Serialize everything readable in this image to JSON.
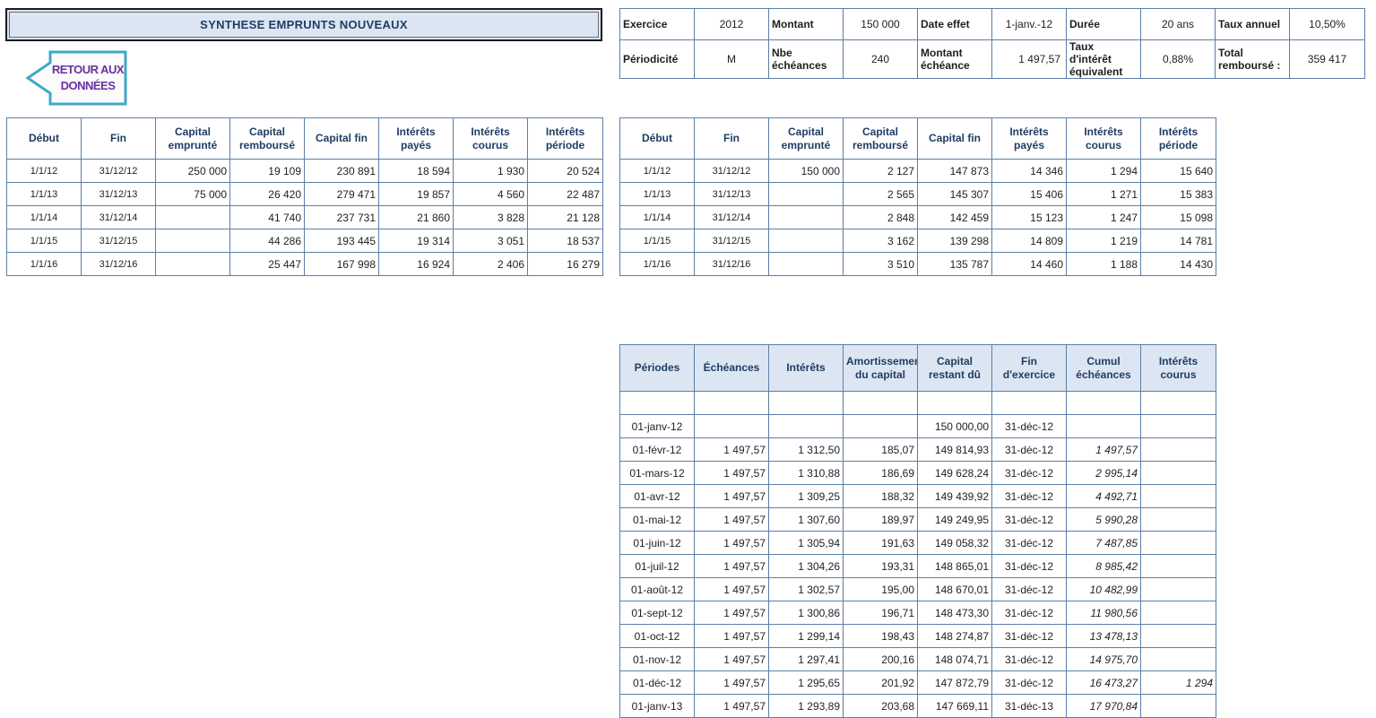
{
  "title": "SYNTHESE EMPRUNTS NOUVEAUX",
  "back_button": {
    "label_line1": "RETOUR AUX",
    "label_line2": "DONNÉES",
    "icon": "arrow-left-icon"
  },
  "summary": {
    "row1": [
      "Exercice",
      "2012",
      "Montant",
      "150 000",
      "Date effet",
      "1-janv.-12",
      "Durée",
      "20 ans",
      "Taux annuel",
      "10,50%"
    ],
    "row2": [
      "Périodicité",
      "M",
      "Nbe échéances",
      "240",
      "Montant échéance",
      "1 497,57",
      "Taux d'intérêt équivalent",
      "0,88%",
      "Total remboursé :",
      "359 417"
    ]
  },
  "synthesis_headers": [
    "Début",
    "Fin",
    "Capital emprunté",
    "Capital remboursé",
    "Capital fin",
    "Intérêts payés",
    "Intérêts courus",
    "Intérêts période"
  ],
  "synthesis_left": [
    [
      "1/1/12",
      "31/12/12",
      "250 000",
      "19 109",
      "230 891",
      "18 594",
      "1 930",
      "20 524"
    ],
    [
      "1/1/13",
      "31/12/13",
      "75 000",
      "26 420",
      "279 471",
      "19 857",
      "4 560",
      "22 487"
    ],
    [
      "1/1/14",
      "31/12/14",
      "",
      "41 740",
      "237 731",
      "21 860",
      "3 828",
      "21 128"
    ],
    [
      "1/1/15",
      "31/12/15",
      "",
      "44 286",
      "193 445",
      "19 314",
      "3 051",
      "18 537"
    ],
    [
      "1/1/16",
      "31/12/16",
      "",
      "25 447",
      "167 998",
      "16 924",
      "2 406",
      "16 279"
    ]
  ],
  "synthesis_right": [
    [
      "1/1/12",
      "31/12/12",
      "150 000",
      "2 127",
      "147 873",
      "14 346",
      "1 294",
      "15 640"
    ],
    [
      "1/1/13",
      "31/12/13",
      "",
      "2 565",
      "145 307",
      "15 406",
      "1 271",
      "15 383"
    ],
    [
      "1/1/14",
      "31/12/14",
      "",
      "2 848",
      "142 459",
      "15 123",
      "1 247",
      "15 098"
    ],
    [
      "1/1/15",
      "31/12/15",
      "",
      "3 162",
      "139 298",
      "14 809",
      "1 219",
      "14 781"
    ],
    [
      "1/1/16",
      "31/12/16",
      "",
      "3 510",
      "135 787",
      "14 460",
      "1 188",
      "14 430"
    ]
  ],
  "schedule_headers": [
    "Périodes",
    "Échéances",
    "Intérêts",
    "Amortissement du capital",
    "Capital restant dû",
    "Fin d'exercice",
    "Cumul échéances",
    "Intérêts courus"
  ],
  "schedule_rows": [
    [
      "",
      "",
      "",
      "",
      "",
      "",
      "",
      ""
    ],
    [
      "01-janv-12",
      "",
      "",
      "",
      "150 000,00",
      "31-déc-12",
      "",
      ""
    ],
    [
      "01-févr-12",
      "1 497,57",
      "1 312,50",
      "185,07",
      "149 814,93",
      "31-déc-12",
      "1 497,57",
      ""
    ],
    [
      "01-mars-12",
      "1 497,57",
      "1 310,88",
      "186,69",
      "149 628,24",
      "31-déc-12",
      "2 995,14",
      ""
    ],
    [
      "01-avr-12",
      "1 497,57",
      "1 309,25",
      "188,32",
      "149 439,92",
      "31-déc-12",
      "4 492,71",
      ""
    ],
    [
      "01-mai-12",
      "1 497,57",
      "1 307,60",
      "189,97",
      "149 249,95",
      "31-déc-12",
      "5 990,28",
      ""
    ],
    [
      "01-juin-12",
      "1 497,57",
      "1 305,94",
      "191,63",
      "149 058,32",
      "31-déc-12",
      "7 487,85",
      ""
    ],
    [
      "01-juil-12",
      "1 497,57",
      "1 304,26",
      "193,31",
      "148 865,01",
      "31-déc-12",
      "8 985,42",
      ""
    ],
    [
      "01-août-12",
      "1 497,57",
      "1 302,57",
      "195,00",
      "148 670,01",
      "31-déc-12",
      "10 482,99",
      ""
    ],
    [
      "01-sept-12",
      "1 497,57",
      "1 300,86",
      "196,71",
      "148 473,30",
      "31-déc-12",
      "11 980,56",
      ""
    ],
    [
      "01-oct-12",
      "1 497,57",
      "1 299,14",
      "198,43",
      "148 274,87",
      "31-déc-12",
      "13 478,13",
      ""
    ],
    [
      "01-nov-12",
      "1 497,57",
      "1 297,41",
      "200,16",
      "148 074,71",
      "31-déc-12",
      "14 975,70",
      ""
    ],
    [
      "01-déc-12",
      "1 497,57",
      "1 295,65",
      "201,92",
      "147 872,79",
      "31-déc-12",
      "16 473,27",
      "1 294"
    ],
    [
      "01-janv-13",
      "1 497,57",
      "1 293,89",
      "203,68",
      "147 669,11",
      "31-déc-13",
      "17 970,84",
      ""
    ]
  ],
  "colors": {
    "accent": "#1f3d63",
    "border": "#5b7fa6",
    "header_fill": "#dce6f2",
    "button_text": "#6b2fa0",
    "button_border": "#3fa8c8"
  }
}
